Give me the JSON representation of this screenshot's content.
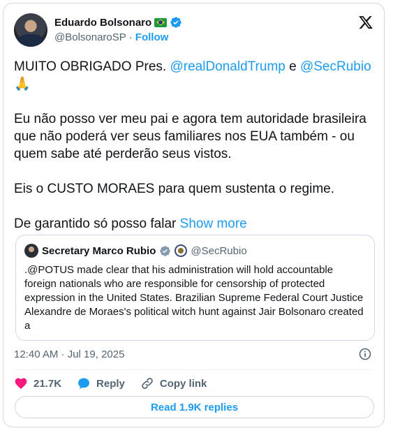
{
  "author": {
    "name": "Eduardo Bolsonaro",
    "handle": "@BolsonaroSP",
    "separator": "·",
    "follow_label": "Follow"
  },
  "tweet": {
    "line1_prefix": "MUITO OBRIGADO Pres. ",
    "mention1": "@realDonaldTrump",
    "line1_mid": " e ",
    "mention2": "@SecRubio",
    "emoji": "🙏",
    "para2": "Eu não posso ver meu pai e agora tem autoridade brasileira que não poderá ver seus familiares nos EUA também - ou quem sabe até perderão seus vistos.",
    "para3": "Eis o CUSTO MORAES para quem sustenta o regime.",
    "para4": "De garantido só posso falar ",
    "show_more": "Show more"
  },
  "quote": {
    "name": "Secretary Marco Rubio",
    "handle": "@SecRubio",
    "text": ".@POTUS made clear that his administration will hold accountable foreign nationals who are responsible for censorship of protected expression in the United States. Brazilian Supreme Federal Court Justice Alexandre de Moraes's political witch hunt against Jair Bolsonaro created a"
  },
  "meta": {
    "timestamp": "12:40 AM · Jul 19, 2025"
  },
  "actions": {
    "likes": "21.7K",
    "reply_label": "Reply",
    "copy_link_label": "Copy link"
  },
  "read_replies_label": "Read 1.9K replies",
  "colors": {
    "accent": "#1d9bf0",
    "like": "#f91880",
    "muted": "#536471"
  }
}
